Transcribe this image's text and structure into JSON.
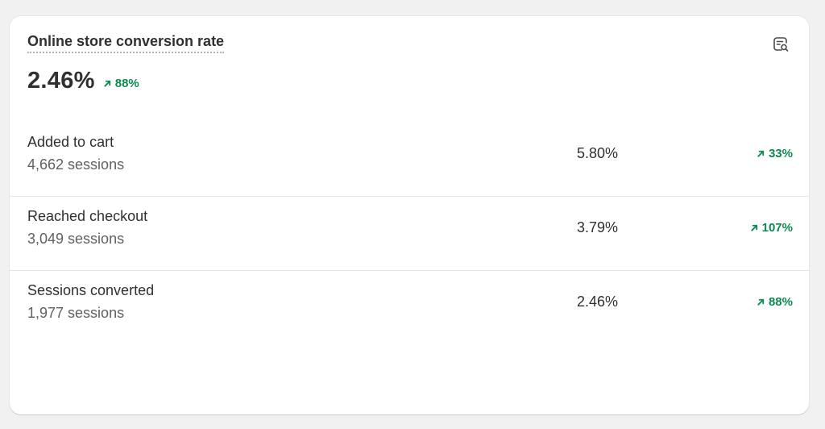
{
  "card": {
    "title": "Online store conversion rate",
    "value": "2.46%",
    "change": "88%",
    "icon": "report-search-icon"
  },
  "rows": [
    {
      "label": "Added to cart",
      "sessions": "4,662 sessions",
      "rate": "5.80%",
      "change": "33%"
    },
    {
      "label": "Reached checkout",
      "sessions": "3,049 sessions",
      "rate": "3.79%",
      "change": "107%"
    },
    {
      "label": "Sessions converted",
      "sessions": "1,977 sessions",
      "rate": "2.46%",
      "change": "88%"
    }
  ],
  "colors": {
    "positive": "#0c8a52",
    "text": "#303030",
    "muted": "#616161",
    "background": "#f1f1f1"
  }
}
